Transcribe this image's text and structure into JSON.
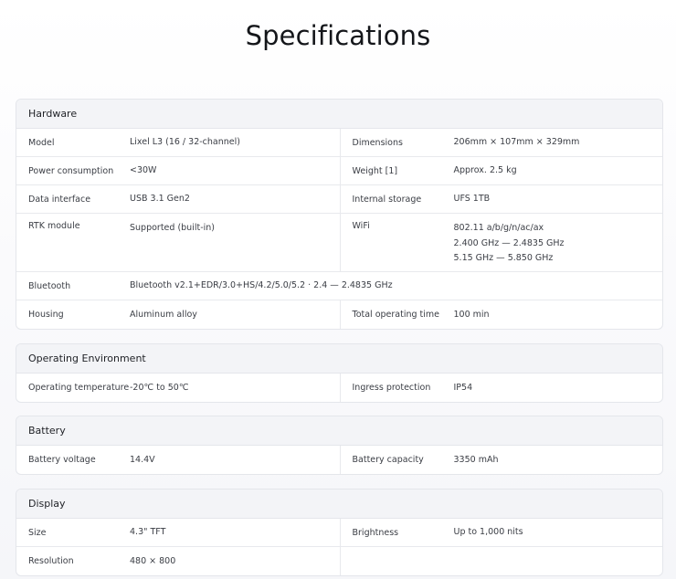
{
  "page_title": "Specifications",
  "hardware": {
    "title": "Hardware",
    "model_label": "Model",
    "model_value": "Lixel L3 (16 / 32-channel)",
    "dimensions_label": "Dimensions",
    "dimensions_value": "206mm × 107mm × 329mm",
    "power_label": "Power consumption",
    "power_value": "<30W",
    "weight_label": "Weight [1]",
    "weight_value": "Approx. 2.5 kg",
    "data_interface_label": "Data interface",
    "data_interface_value": "USB 3.1 Gen2",
    "storage_label": "Internal storage",
    "storage_value": "UFS 1TB",
    "rtk_label": "RTK module",
    "rtk_value": "Supported (built-in)",
    "wifi_label": "WiFi",
    "wifi_lines": [
      "802.11 a/b/g/n/ac/ax",
      "2.400 GHz — 2.4835 GHz",
      "5.15 GHz — 5.850 GHz"
    ],
    "bluetooth_label": "Bluetooth",
    "bluetooth_value": "Bluetooth v2.1+EDR/3.0+HS/4.2/5.0/5.2 · 2.4 — 2.4835 GHz",
    "housing_label": "Housing",
    "housing_value": "Aluminum alloy",
    "operating_time_label": "Total operating time",
    "operating_time_value": "100 min"
  },
  "environment": {
    "title": "Operating Environment",
    "temp_label": "Operating temperature",
    "temp_value": "-20℃ to 50℃",
    "ingress_label": "Ingress protection",
    "ingress_value": "IP54"
  },
  "battery": {
    "title": "Battery",
    "voltage_label": "Battery voltage",
    "voltage_value": "14.4V",
    "capacity_label": "Battery capacity",
    "capacity_value": "3350 mAh"
  },
  "display": {
    "title": "Display",
    "size_label": "Size",
    "size_value": "4.3\" TFT",
    "brightness_label": "Brightness",
    "brightness_value": "Up to 1,000 nits",
    "resolution_label": "Resolution",
    "resolution_value": "480 × 800"
  }
}
